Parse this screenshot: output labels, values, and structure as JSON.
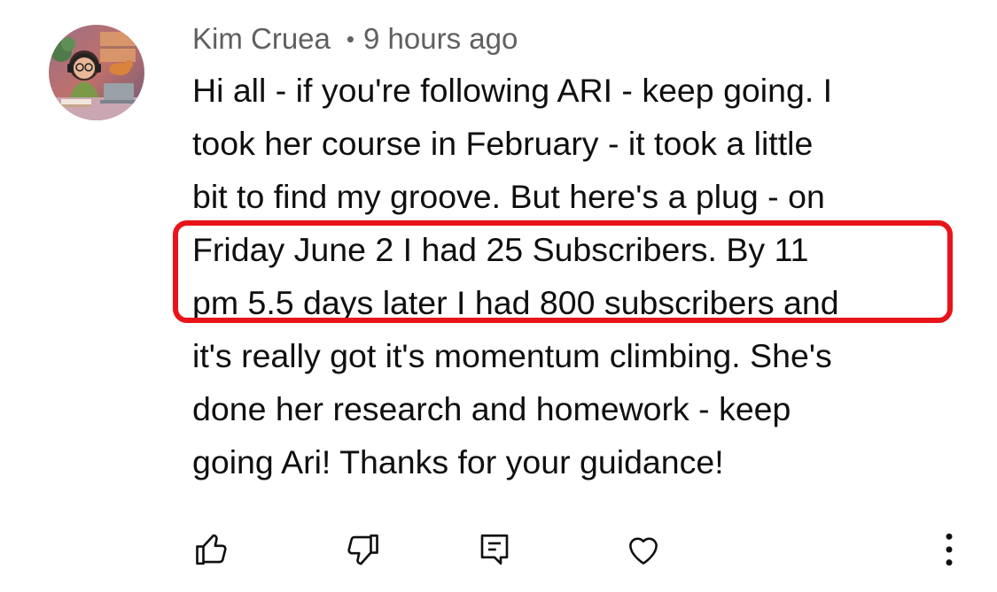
{
  "comment": {
    "author": "Kim Cruea",
    "separator": "•",
    "timestamp": "9 hours ago",
    "lines": [
      "Hi all - if you're following ARI - keep going. I",
      "took her course in February - it took a little",
      "bit to find my groove. But here's a plug - on",
      "Friday June 2 I had 25 Subscribers. By 11",
      "pm 5.5 days later I had 800 subscribers and",
      "it's really got it's momentum climbing. She's",
      "done her research and homework - keep",
      "going Ari! Thanks for your guidance!"
    ]
  },
  "annotation": {
    "color": "#e8141a"
  },
  "actions": {
    "icons": [
      "thumbs-up-icon",
      "thumbs-down-icon",
      "reply-icon",
      "heart-icon",
      "more-vertical-icon"
    ]
  }
}
